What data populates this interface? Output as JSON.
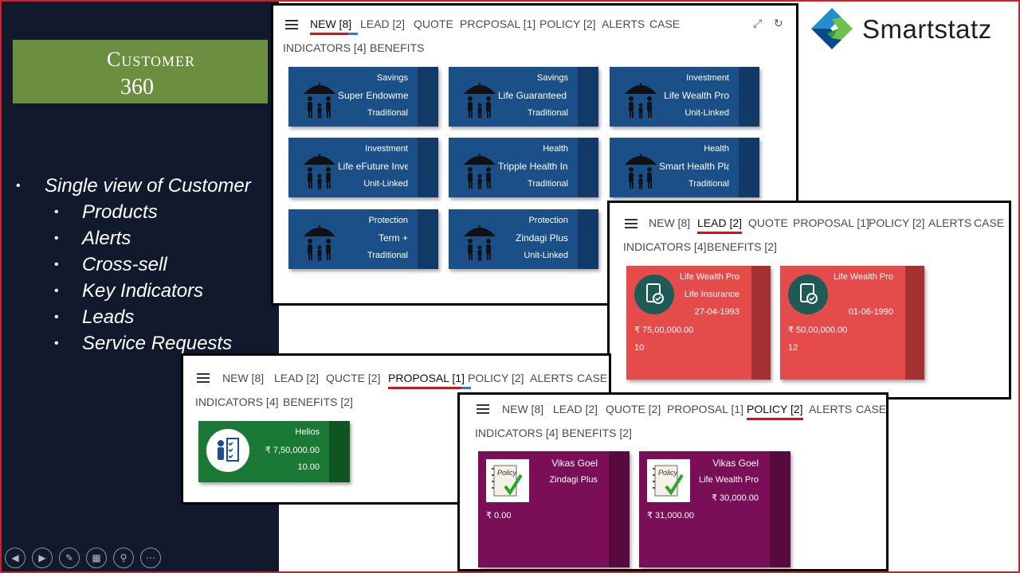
{
  "slide": {
    "title_line1": "Customer",
    "title_line2": "360",
    "bullet_main": "Single view of Customer",
    "bullets_sub": [
      "Products",
      "Alerts",
      "Cross-sell",
      "Key Indicators",
      "Leads",
      "Service Requests"
    ]
  },
  "logo": {
    "text": "Smartstatz"
  },
  "colors": {
    "accent_red": "#d0121b",
    "product_blue": "#1b4f87",
    "lead_red": "#e64b4b",
    "proposal_green": "#1a7a35",
    "policy_purple": "#7a0f57",
    "slide_bg": "#111a2d",
    "title_green": "#6b8e3f"
  },
  "panel_new": {
    "tabs": [
      "NEW [8]",
      "LEAD [2]",
      "QUOTE",
      "PRCPOSAL [1]",
      "POLICY [2]",
      "ALERTS",
      "CASE"
    ],
    "tabs_row2": [
      "INDICATORS [4]",
      "BENEFITS"
    ],
    "active_tab": "NEW [8]",
    "expand_icon": "expand-icon",
    "refresh_icon": "refresh-icon",
    "cards": [
      {
        "category": "Savings",
        "name": "Super Endowmer",
        "type": "Traditional"
      },
      {
        "category": "Savings",
        "name": "Life Guaranteed I",
        "type": "Traditional"
      },
      {
        "category": "Investment",
        "name": "Life Wealth Pro",
        "type": "Unit-Linked"
      },
      {
        "category": "Investment",
        "name": "Life eFuture Inve",
        "type": "Unit-Linked"
      },
      {
        "category": "Health",
        "name": "Tripple Health Ins",
        "type": "Traditional"
      },
      {
        "category": "Health",
        "name": "Smart Health Plai",
        "type": "Traditional"
      },
      {
        "category": "Protection",
        "name": "Term +",
        "type": "Traditional"
      },
      {
        "category": "Protection",
        "name": "Zindagi Plus",
        "type": "Unit-Linked"
      }
    ]
  },
  "panel_lead": {
    "tabs": [
      "NEW [8]",
      "LEAD [2]",
      "QUOTE",
      "PROPOSAL [1]",
      "POLICY [2]",
      "ALERTS",
      "CASE"
    ],
    "tabs_row2": [
      "INDICATORS [4]",
      "BENEFITS [2]"
    ],
    "active_tab": "LEAD [2]",
    "cards": [
      {
        "product": "Life Wealth Pro",
        "category": "Life Insurance",
        "date": "27-04-1993",
        "amount": "₹ 75,00,000.00",
        "count": "10"
      },
      {
        "product": "Life Wealth Pro",
        "category": "",
        "date": "01-06-1990",
        "amount": "₹ 50,00,000.00",
        "count": "12"
      }
    ]
  },
  "panel_proposal": {
    "tabs": [
      "NEW [8]",
      "LEAD [2]",
      "QUCTE [2]",
      "PROPOSAL [1]",
      "POLICY [2]",
      "ALERTS",
      "CASE"
    ],
    "tabs_row2": [
      "INDICATORS [4]",
      "BENEFITS [2]"
    ],
    "active_tab": "PROPOSAL [1]",
    "card": {
      "name": "Helios",
      "amount": "₹ 7,50,000.00",
      "value": "10.00"
    }
  },
  "panel_policy": {
    "tabs": [
      "NEW [8]",
      "LEAD [2]",
      "QUOTE [2]",
      "PROPOSAL [1]",
      "POLICY [2]",
      "ALERTS",
      "CASE"
    ],
    "tabs_row2": [
      "INDICATORS [4]",
      "BENEFITS [2]"
    ],
    "active_tab": "POLICY [2]",
    "cards": [
      {
        "holder": "Vikas Goel",
        "product": "Zindagi Plus",
        "premium": "",
        "amount": "₹ 0.00",
        "badge": "Policy"
      },
      {
        "holder": "Vikas Goel",
        "product": "Life Wealth Pro",
        "premium": "₹ 30,000.00",
        "amount": "₹ 31,000.00",
        "badge": "Policy"
      }
    ]
  }
}
